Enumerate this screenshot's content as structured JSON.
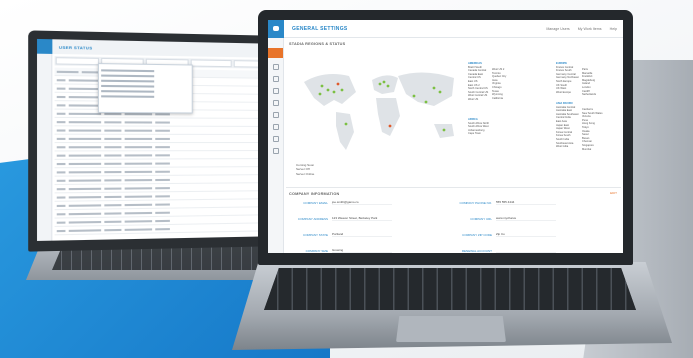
{
  "back_window": {
    "title": "USER STATUS"
  },
  "front_window": {
    "title": "GENERAL SETTINGS",
    "header_items": [
      "Manage Users",
      "My Work Items",
      "Help"
    ],
    "map_section_title": "STADIA REGIONS & STATUS",
    "legend": [
      "Coming Soon",
      "Server Off",
      "Server Online"
    ],
    "region_columns": [
      {
        "heading": "AMERICAS",
        "items": [
          "Brazil South",
          "Canada Central",
          "Canada East",
          "Central US",
          "East US",
          "East US 2",
          "North Central US",
          "South Central US",
          "West Central US",
          "West US"
        ]
      },
      {
        "heading": "",
        "items": [
          "West US 2",
          "Toronto",
          "Quebec City",
          "Iowa",
          "Virginia",
          "Chicago",
          "Texas",
          "Wyoming",
          "California"
        ]
      },
      {
        "heading": "AFRICA",
        "items": [
          "South Africa North",
          "South Africa West",
          "Johannesburg",
          "Cape Town"
        ]
      },
      {
        "heading": "EUROPE",
        "items": [
          "France Central",
          "France South",
          "Germany Central",
          "Germany Northeast",
          "North Europe",
          "UK South",
          "UK West",
          "West Europe"
        ]
      },
      {
        "heading": "",
        "items": [
          "Paris",
          "Marseille",
          "Frankfurt",
          "Magdeburg",
          "Ireland",
          "London",
          "Cardiff",
          "Netherlands"
        ]
      },
      {
        "heading": "ASIA PACIFIC",
        "items": [
          "Australia Central",
          "Australia East",
          "Australia Southeast",
          "Central India",
          "East Asia",
          "Japan East",
          "Japan West",
          "Korea Central",
          "Korea South",
          "South India",
          "Southeast Asia",
          "West India"
        ]
      },
      {
        "heading": "",
        "items": [
          "Canberra",
          "New South Wales",
          "Victoria",
          "Pune",
          "Hong Kong",
          "Tokyo",
          "Osaka",
          "Seoul",
          "Busan",
          "Chennai",
          "Singapore",
          "Mumbai"
        ]
      }
    ],
    "company_section_title": "COMPANY INFORMATION",
    "edit_label": "EDIT",
    "fields_left": [
      {
        "label": "COMPANY EMAIL",
        "value": "joe.smith@gamo.co"
      },
      {
        "label": "COMPANY ADDRESS",
        "value": "123 Weaver Street, Berkeley Park"
      },
      {
        "label": "COMPANY STATE",
        "value": "Portland"
      },
      {
        "label": "COMPANY SIZE",
        "value": "Growing"
      }
    ],
    "fields_right": [
      {
        "label": "COMPANY PHONE NO.",
        "value": "555 555 4444"
      },
      {
        "label": "COMPANY URL",
        "value": "www.mycharve"
      },
      {
        "label": "COMPANY ZIP CODE",
        "value": "Zip Co"
      },
      {
        "label": "RENEWAL ACCOUNT",
        "value": ""
      }
    ]
  },
  "colors": {
    "accent": "#2a88c8",
    "active": "#e8742a",
    "online": "#7cc043",
    "offline": "#e05a2b",
    "background_wedge": "#1f8ad6"
  },
  "icons": [
    "logo-icon",
    "dashboard-icon",
    "users-icon",
    "chart-icon",
    "settings-icon"
  ]
}
